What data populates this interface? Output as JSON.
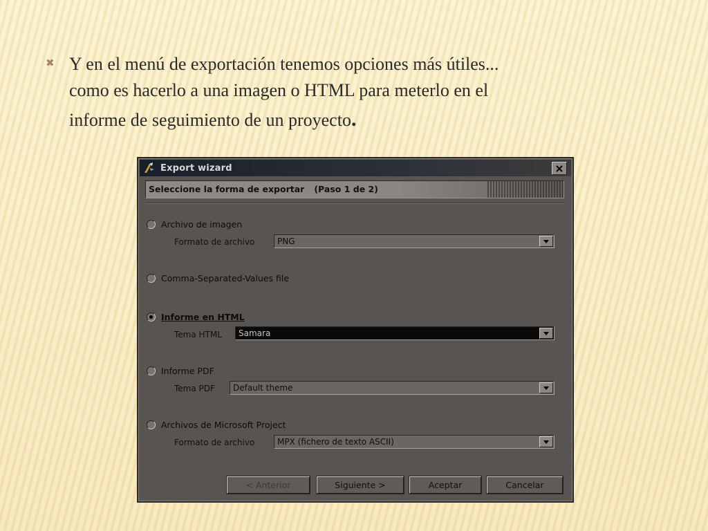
{
  "slide": {
    "bullet_icon": "x-bullet-icon",
    "line1": "Y en el menú de exportación tenemos opciones más útiles...",
    "line2": "como es hacerlo a una imagen o HTML para meterlo en el",
    "line3": "informe de seguimiento de un proyecto",
    "line3_end": "."
  },
  "window": {
    "title": "Export wizard",
    "header": "Seleccione la forma de exportar",
    "step": "(Paso 1 de 2)",
    "options": [
      {
        "label": "Archivo de imagen",
        "checked": false,
        "field_label": "Formato de archivo",
        "value": "PNG"
      },
      {
        "label": "Comma-Separated-Values file",
        "checked": false
      },
      {
        "label": "Informe en HTML",
        "checked": true,
        "field_label": "Tema HTML",
        "value": "Samara"
      },
      {
        "label": "Informe PDF",
        "checked": false,
        "field_label": "Tema PDF",
        "value": "Default theme"
      },
      {
        "label": "Archivos de Microsoft Project",
        "checked": false,
        "field_label": "Formato de archivo",
        "value": "MPX (fichero de texto ASCII)"
      }
    ],
    "buttons": {
      "back": "< Anterior",
      "next": "Siguiente >",
      "accept": "Aceptar",
      "cancel": "Cancelar"
    }
  }
}
